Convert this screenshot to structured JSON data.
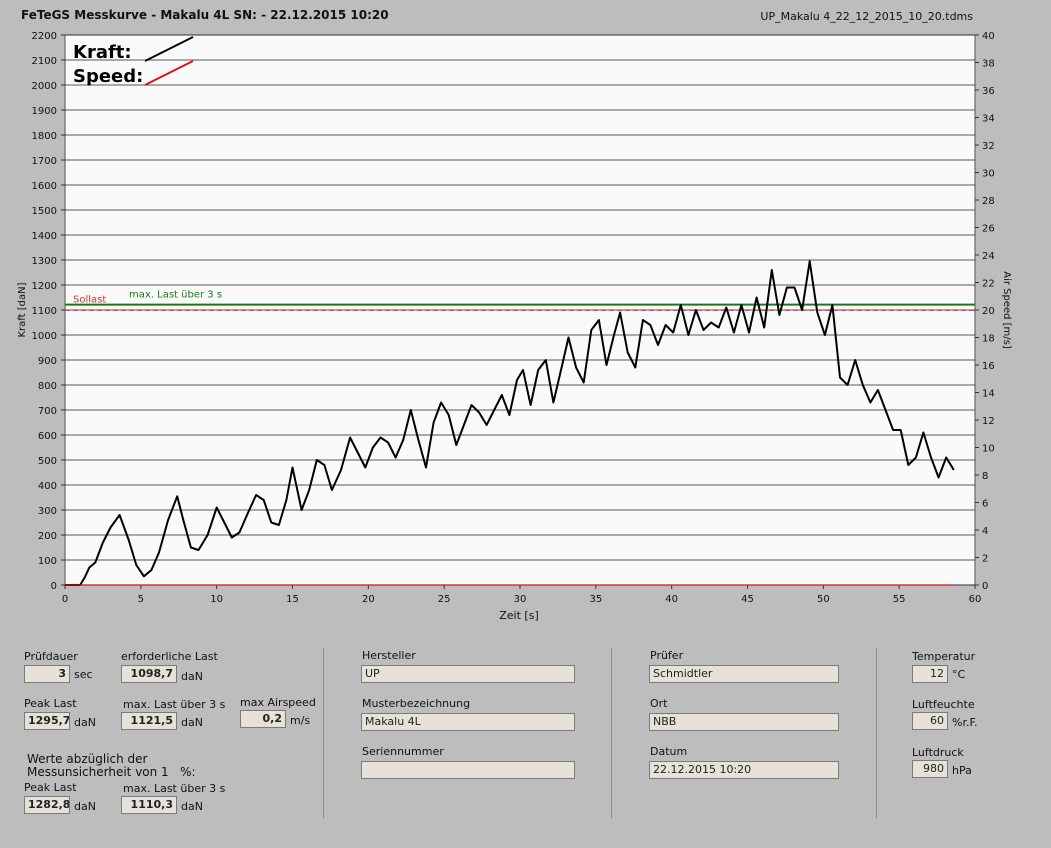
{
  "header": {
    "title": "FeTeGS Messkurve - Makalu 4L  SN:  - 22.12.2015 10:20",
    "filename": "UP_Makalu 4_22_12_2015_10_20.tdms"
  },
  "chart_data": {
    "type": "line",
    "xlabel": "Zeit [s]",
    "ylabel": "Kraft [daN]",
    "y2label": "Air Speed [m/s]",
    "xlim": [
      0,
      60
    ],
    "ylim": [
      0,
      2200
    ],
    "y2lim": [
      0,
      40
    ],
    "x_ticks": [
      "0",
      "5",
      "10",
      "15",
      "20",
      "25",
      "30",
      "35",
      "40",
      "45",
      "50",
      "55",
      "60"
    ],
    "y_ticks": [
      "0",
      "100",
      "200",
      "300",
      "400",
      "500",
      "600",
      "700",
      "800",
      "900",
      "1000",
      "1100",
      "1200",
      "1300",
      "1400",
      "1500",
      "1600",
      "1700",
      "1800",
      "1900",
      "2000",
      "2100",
      "2200"
    ],
    "y2_ticks": [
      "0",
      "2",
      "4",
      "6",
      "8",
      "10",
      "12",
      "14",
      "16",
      "18",
      "20",
      "22",
      "24",
      "26",
      "28",
      "30",
      "32",
      "34",
      "36",
      "38",
      "40"
    ],
    "grid": true,
    "legend": [
      {
        "name": "Kraft:",
        "color": "#000000"
      },
      {
        "name": "Speed:",
        "color": "#dd1111"
      }
    ],
    "reference_lines": [
      {
        "label": "Sollast",
        "value": 1098.7,
        "color": "#cc3333",
        "dashed": true
      },
      {
        "label": "max. Last über  3 s",
        "value": 1121.5,
        "color": "#1a7a1a",
        "dashed": false
      }
    ],
    "series": [
      {
        "name": "Kraft",
        "color": "#000000",
        "points": [
          [
            0,
            0
          ],
          [
            1,
            0
          ],
          [
            1.3,
            30
          ],
          [
            1.6,
            70
          ],
          [
            2,
            90
          ],
          [
            2.5,
            170
          ],
          [
            3,
            230
          ],
          [
            3.6,
            280
          ],
          [
            4.2,
            180
          ],
          [
            4.7,
            80
          ],
          [
            5.2,
            35
          ],
          [
            5.7,
            60
          ],
          [
            6.2,
            130
          ],
          [
            6.8,
            260
          ],
          [
            7.4,
            355
          ],
          [
            7.8,
            260
          ],
          [
            8.3,
            150
          ],
          [
            8.8,
            140
          ],
          [
            9.4,
            200
          ],
          [
            10,
            310
          ],
          [
            10.5,
            250
          ],
          [
            11,
            190
          ],
          [
            11.5,
            210
          ],
          [
            12,
            280
          ],
          [
            12.6,
            360
          ],
          [
            13.1,
            340
          ],
          [
            13.6,
            250
          ],
          [
            14.1,
            240
          ],
          [
            14.6,
            340
          ],
          [
            15,
            470
          ],
          [
            15.6,
            300
          ],
          [
            16.1,
            380
          ],
          [
            16.6,
            500
          ],
          [
            17.1,
            480
          ],
          [
            17.6,
            380
          ],
          [
            18.2,
            460
          ],
          [
            18.8,
            590
          ],
          [
            19.3,
            530
          ],
          [
            19.8,
            470
          ],
          [
            20.3,
            550
          ],
          [
            20.8,
            590
          ],
          [
            21.3,
            570
          ],
          [
            21.8,
            510
          ],
          [
            22.3,
            580
          ],
          [
            22.8,
            700
          ],
          [
            23.3,
            580
          ],
          [
            23.8,
            470
          ],
          [
            24.3,
            650
          ],
          [
            24.8,
            730
          ],
          [
            25.3,
            680
          ],
          [
            25.8,
            560
          ],
          [
            26.3,
            640
          ],
          [
            26.8,
            720
          ],
          [
            27.3,
            690
          ],
          [
            27.8,
            640
          ],
          [
            28.3,
            700
          ],
          [
            28.8,
            760
          ],
          [
            29.3,
            680
          ],
          [
            29.8,
            820
          ],
          [
            30.2,
            860
          ],
          [
            30.7,
            720
          ],
          [
            31.2,
            860
          ],
          [
            31.7,
            900
          ],
          [
            32.2,
            730
          ],
          [
            32.7,
            860
          ],
          [
            33.2,
            990
          ],
          [
            33.7,
            870
          ],
          [
            34.2,
            810
          ],
          [
            34.7,
            1020
          ],
          [
            35.2,
            1060
          ],
          [
            35.7,
            880
          ],
          [
            36.2,
            1000
          ],
          [
            36.6,
            1090
          ],
          [
            37.1,
            930
          ],
          [
            37.6,
            870
          ],
          [
            38.1,
            1060
          ],
          [
            38.6,
            1040
          ],
          [
            39.1,
            960
          ],
          [
            39.6,
            1040
          ],
          [
            40.1,
            1010
          ],
          [
            40.6,
            1120
          ],
          [
            41.1,
            1000
          ],
          [
            41.6,
            1100
          ],
          [
            42.1,
            1020
          ],
          [
            42.6,
            1050
          ],
          [
            43.1,
            1030
          ],
          [
            43.6,
            1110
          ],
          [
            44.1,
            1010
          ],
          [
            44.6,
            1120
          ],
          [
            45.1,
            1010
          ],
          [
            45.6,
            1150
          ],
          [
            46.1,
            1030
          ],
          [
            46.6,
            1260
          ],
          [
            47.1,
            1080
          ],
          [
            47.6,
            1190
          ],
          [
            48.1,
            1190
          ],
          [
            48.6,
            1100
          ],
          [
            49.1,
            1295
          ],
          [
            49.6,
            1090
          ],
          [
            50.1,
            1000
          ],
          [
            50.6,
            1120
          ],
          [
            51.1,
            830
          ],
          [
            51.6,
            800
          ],
          [
            52.1,
            900
          ],
          [
            52.6,
            800
          ],
          [
            53.1,
            730
          ],
          [
            53.6,
            780
          ],
          [
            54.1,
            700
          ],
          [
            54.6,
            620
          ],
          [
            55.1,
            620
          ],
          [
            55.6,
            480
          ],
          [
            56.1,
            510
          ],
          [
            56.6,
            610
          ],
          [
            57.1,
            510
          ],
          [
            57.6,
            430
          ],
          [
            58.1,
            510
          ],
          [
            58.6,
            460
          ]
        ]
      },
      {
        "name": "Speed",
        "color": "#dd1111",
        "points": [
          [
            0,
            0
          ],
          [
            58.6,
            0
          ]
        ]
      }
    ]
  },
  "params": {
    "pruefdauer": {
      "label": "Prüfdauer",
      "value": "3",
      "unit": "sec"
    },
    "erforderliche_last": {
      "label": "erforderliche Last",
      "value": "1098,7",
      "unit": "daN"
    },
    "peak_last": {
      "label": "Peak Last",
      "value": "1295,7",
      "unit": "daN"
    },
    "max_last": {
      "label": "max. Last über  3 s",
      "value": "1121,5",
      "unit": "daN"
    },
    "max_airspeed": {
      "label": "max Airspeed",
      "value": "0,2",
      "unit": "m/s"
    },
    "note": "Werte abzüglich der\nMessunsicherheit von 1   %:",
    "peak_last_corr": {
      "label": "Peak Last",
      "value": "1282,8",
      "unit": "daN"
    },
    "max_last_corr": {
      "label": "max. Last über  3 s",
      "value": "1110,3",
      "unit": "daN"
    }
  },
  "info": {
    "hersteller": {
      "label": "Hersteller",
      "value": "UP"
    },
    "muster": {
      "label": "Musterbezeichnung",
      "value": "Makalu 4L"
    },
    "serien": {
      "label": "Seriennummer",
      "value": ""
    },
    "pruefer": {
      "label": "Prüfer",
      "value": "Schmidtler"
    },
    "ort": {
      "label": "Ort",
      "value": "NBB"
    },
    "datum": {
      "label": "Datum",
      "value": "22.12.2015 10:20"
    }
  },
  "env": {
    "temperatur": {
      "label": "Temperatur",
      "value": "12",
      "unit": "°C"
    },
    "luftfeuchte": {
      "label": "Luftfeuchte",
      "value": "60",
      "unit": "%r.F."
    },
    "luftdruck": {
      "label": "Luftdruck",
      "value": "980",
      "unit": "hPa"
    }
  }
}
